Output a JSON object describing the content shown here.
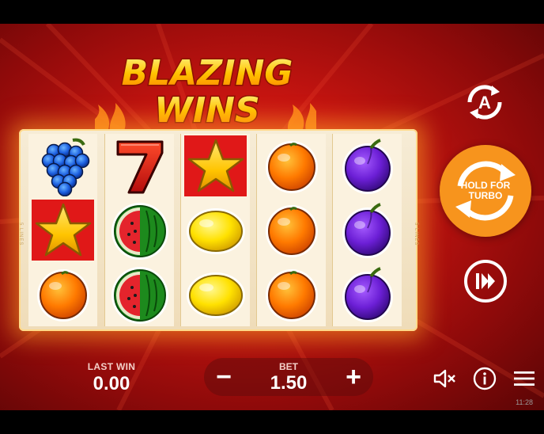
{
  "game": {
    "logo_line1": "BLAZING",
    "logo_line2": "WINS",
    "reel_side_label": "5 LINES"
  },
  "reels": [
    [
      "grapes",
      "star",
      "orange"
    ],
    [
      "seven",
      "watermelon",
      "watermelon"
    ],
    [
      "star",
      "lemon",
      "lemon"
    ],
    [
      "orange",
      "orange",
      "orange"
    ],
    [
      "plum",
      "plum",
      "plum"
    ]
  ],
  "controls": {
    "autoplay_icon": "autoplay-icon",
    "autoplay_letter": "A",
    "turbo_label_line1": "HOLD FOR",
    "turbo_label_line2": "TURBO",
    "skip_icon": "fast-forward-icon"
  },
  "bottom_bar": {
    "last_win_label": "LAST WIN",
    "last_win_value": "0.00",
    "bet_label": "BET",
    "bet_value": "1.50",
    "minus": "−",
    "plus": "+",
    "sound_icon": "sound-muted-icon",
    "info_icon": "info-icon",
    "menu_icon": "menu-icon"
  },
  "status": {
    "clock": "11:28"
  },
  "colors": {
    "background_red": "#c41410",
    "turbo_orange": "#f7941d",
    "reel_cream": "#fbf2df"
  }
}
